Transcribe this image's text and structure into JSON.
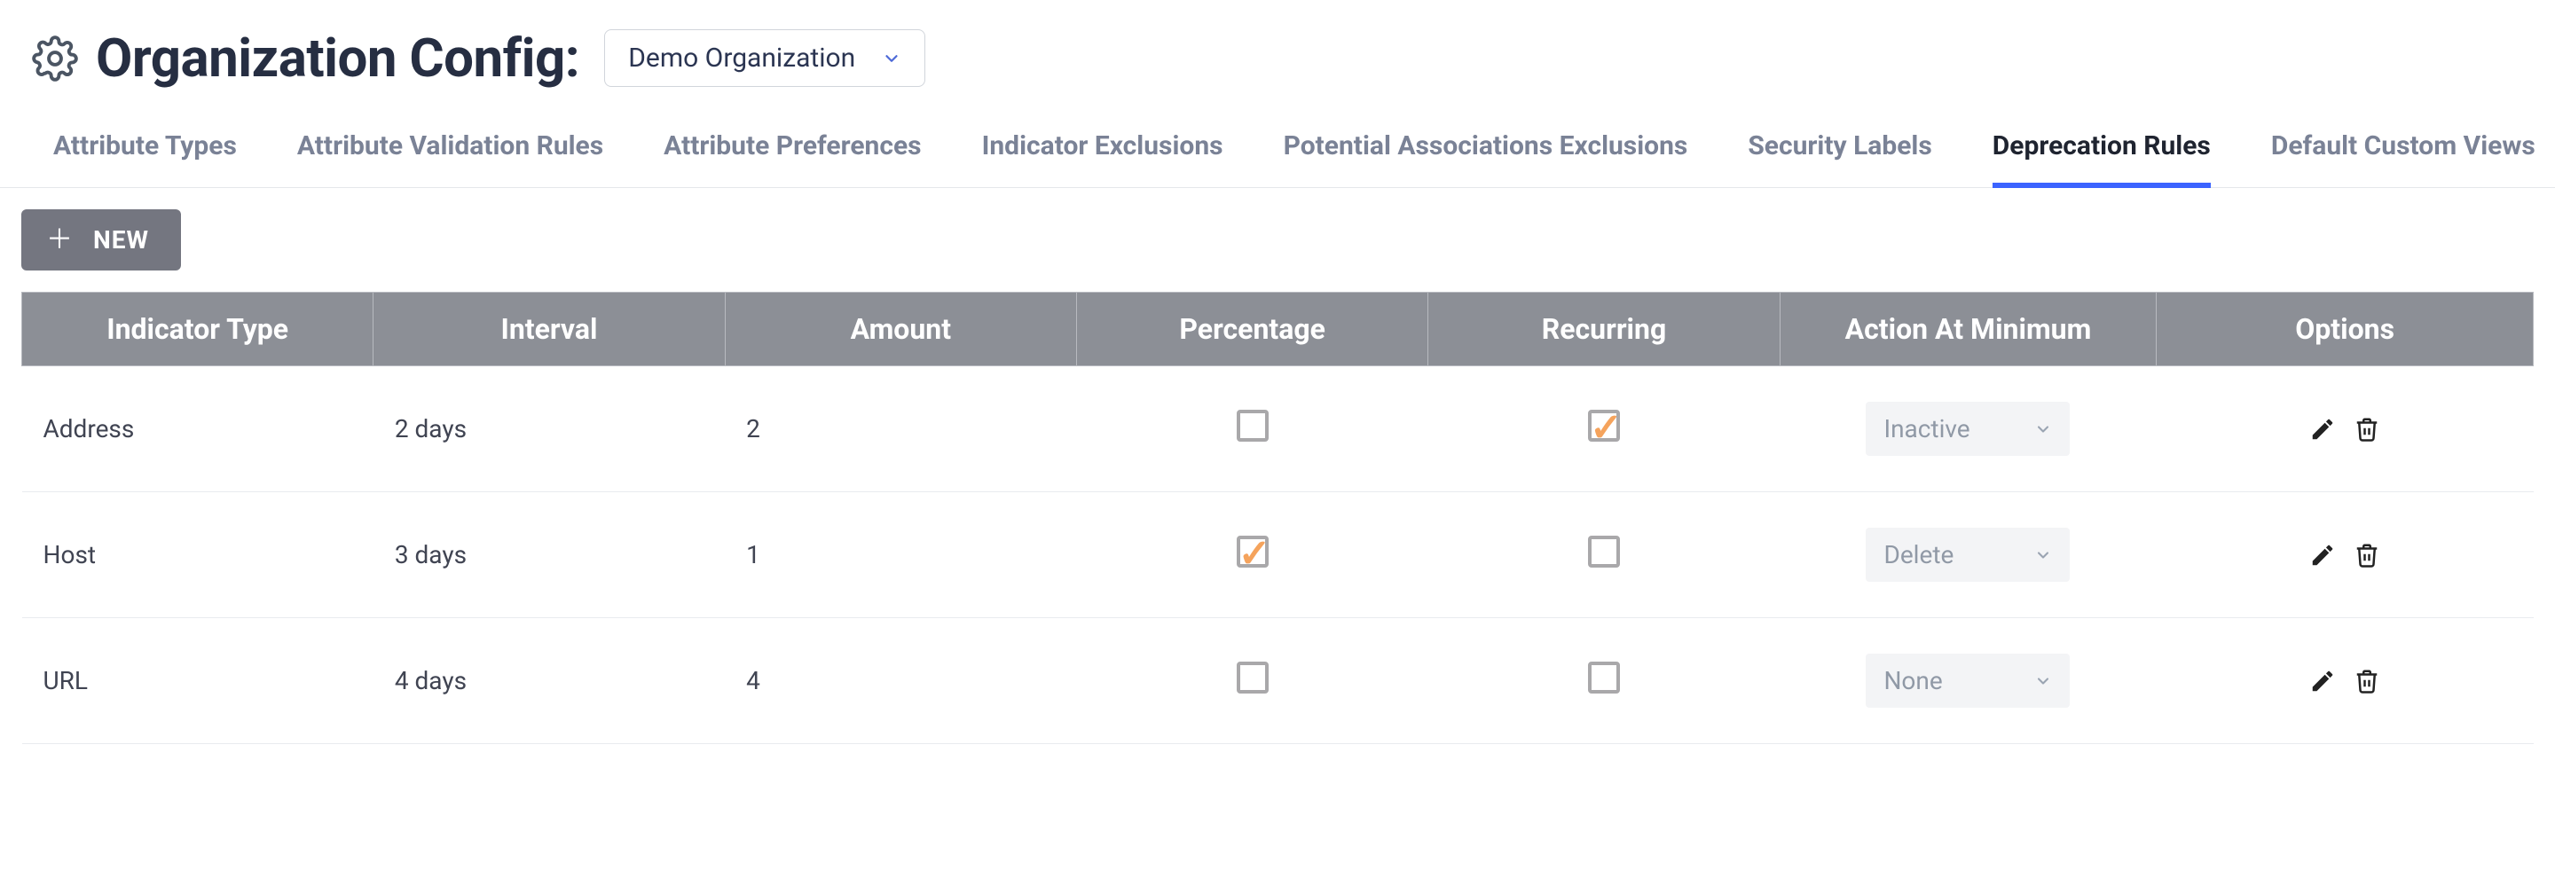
{
  "header": {
    "title": "Organization Config:",
    "org_selected": "Demo Organization"
  },
  "tabs": [
    {
      "label": "Attribute Types",
      "active": false
    },
    {
      "label": "Attribute Validation Rules",
      "active": false
    },
    {
      "label": "Attribute Preferences",
      "active": false
    },
    {
      "label": "Indicator Exclusions",
      "active": false
    },
    {
      "label": "Potential Associations Exclusions",
      "active": false
    },
    {
      "label": "Security Labels",
      "active": false
    },
    {
      "label": "Deprecation Rules",
      "active": true
    },
    {
      "label": "Default Custom Views",
      "active": false
    }
  ],
  "buttons": {
    "new_label": "NEW"
  },
  "table": {
    "headers": {
      "indicator_type": "Indicator Type",
      "interval": "Interval",
      "amount": "Amount",
      "percentage": "Percentage",
      "recurring": "Recurring",
      "action_at_minimum": "Action At Minimum",
      "options": "Options"
    },
    "rows": [
      {
        "indicator_type": "Address",
        "interval": "2 days",
        "amount": "2",
        "percentage": false,
        "recurring": true,
        "action": "Inactive"
      },
      {
        "indicator_type": "Host",
        "interval": "3 days",
        "amount": "1",
        "percentage": true,
        "recurring": false,
        "action": "Delete"
      },
      {
        "indicator_type": "URL",
        "interval": "4 days",
        "amount": "4",
        "percentage": false,
        "recurring": false,
        "action": "None"
      }
    ]
  }
}
